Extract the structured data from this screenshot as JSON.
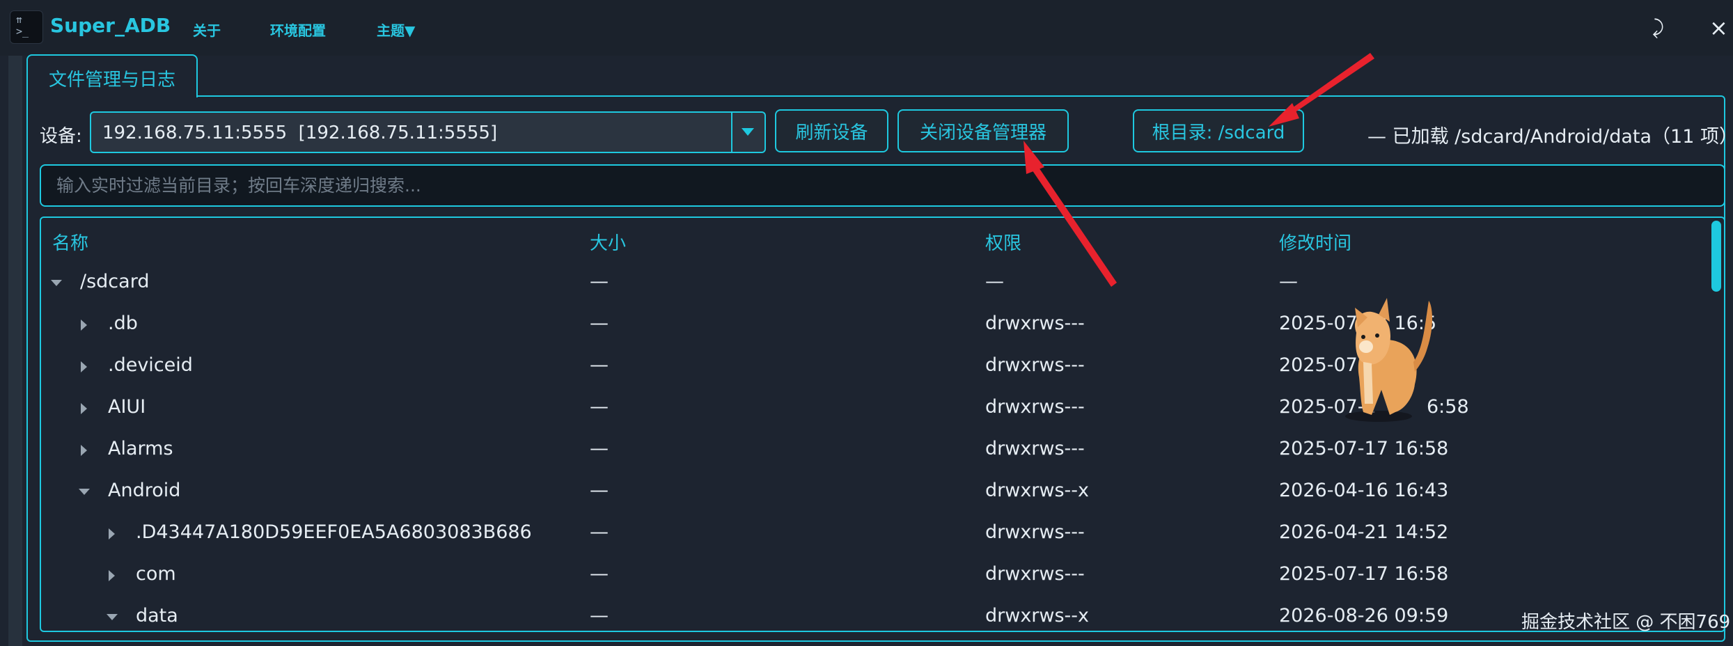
{
  "app": {
    "title": "Super_ADB",
    "icon_text": "⇈\n>_",
    "menu": [
      "关于",
      "环境配置",
      "主题▼"
    ],
    "window_controls": {
      "pin": "⤸",
      "close": "×"
    }
  },
  "tab": {
    "label": "文件管理与日志"
  },
  "device": {
    "label": "设备:",
    "selected": "192.168.75.11:5555  [192.168.75.11:5555]"
  },
  "buttons": {
    "refresh": "刷新设备",
    "close_manager": "关闭设备管理器",
    "root": "根目录: /sdcard"
  },
  "status": "—  已加载 /sdcard/Android/data（11 项）",
  "filter": {
    "placeholder": "输入实时过滤当前目录；按回车深度递归搜索..."
  },
  "table": {
    "columns": [
      "名称",
      "大小",
      "权限",
      "修改时间"
    ],
    "rows": [
      {
        "name": "/sdcard",
        "size": "—",
        "perm": "—",
        "mtime": "—",
        "depth": 0,
        "expanded": true
      },
      {
        "name": ".db",
        "size": "—",
        "perm": "drwxrws---",
        "mtime": "2025-07-17 16:5",
        "depth": 1,
        "expanded": false
      },
      {
        "name": ".deviceid",
        "size": "—",
        "perm": "drwxrws---",
        "mtime": "2025-07-1",
        "depth": 1,
        "expanded": false
      },
      {
        "name": "AIUI",
        "size": "—",
        "perm": "drwxrws---",
        "mtime": "2025-07-1",
        "mtime_tail": "6:58",
        "depth": 1,
        "expanded": false
      },
      {
        "name": "Alarms",
        "size": "—",
        "perm": "drwxrws---",
        "mtime": "2025-07-17 16:58",
        "depth": 1,
        "expanded": false
      },
      {
        "name": "Android",
        "size": "—",
        "perm": "drwxrws--x",
        "mtime": "2026-04-16 16:43",
        "depth": 1,
        "expanded": true
      },
      {
        "name": ".D43447A180D59EEF0EA5A6803083B686",
        "size": "—",
        "perm": "drwxrws---",
        "mtime": "2026-04-21 14:52",
        "depth": 2,
        "expanded": false
      },
      {
        "name": "com",
        "size": "—",
        "perm": "drwxrws---",
        "mtime": "2025-07-17 16:58",
        "depth": 2,
        "expanded": false
      },
      {
        "name": "data",
        "size": "—",
        "perm": "drwxrws--x",
        "mtime": "2026-08-26 09:59",
        "depth": 2,
        "expanded": true
      }
    ]
  },
  "watermark": "掘金技术社区 @ 不困769",
  "colors": {
    "accent": "#1ec9e0",
    "background": "#1d2430",
    "annotation_arrow": "#e8222d"
  }
}
